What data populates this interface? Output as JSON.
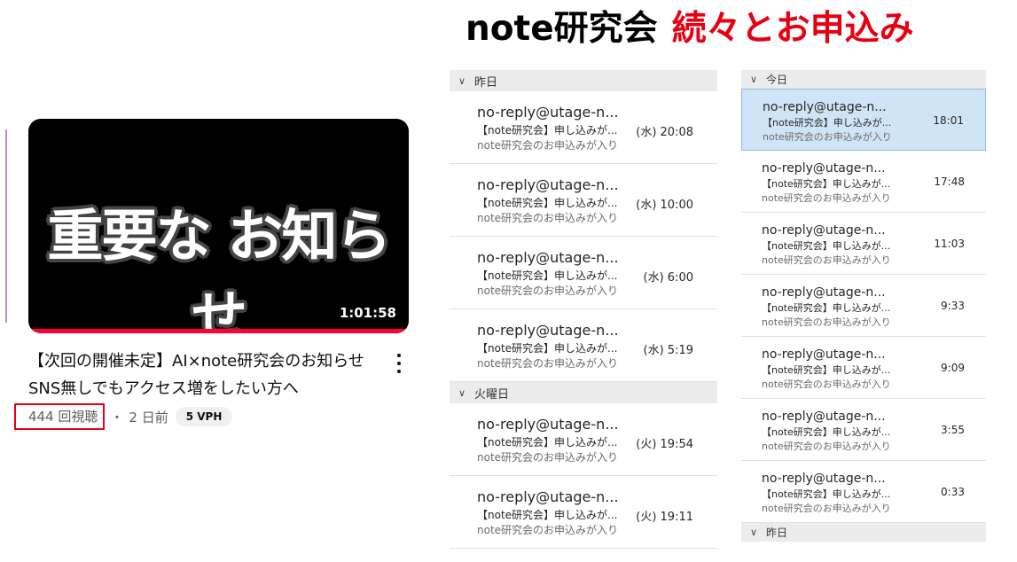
{
  "headline": {
    "part1": "note研究会",
    "part2": "続々とお申込み"
  },
  "video": {
    "thumbnail_text": "重要な お知らせ",
    "duration": "1:01:58",
    "watch_progress": 1.0,
    "title": "【次回の開催未定】AI×note研究会のお知らせ SNS無しでもアクセス増をしたい方へ",
    "views": "444 回視聴",
    "separator": "・",
    "age": "2 日前",
    "vph": "5 VPH",
    "colors": {
      "progress": "#ff0033",
      "highlight_box": "#e60012"
    }
  },
  "mail_list_1": {
    "groups": [
      {
        "label": "昨日",
        "items": [
          {
            "sender": "no-reply@utage-n...",
            "subject": "【note研究会】申し込みが...",
            "preview": "note研究会のお申込みが入り",
            "time": "(水) 20:08"
          },
          {
            "sender": "no-reply@utage-n...",
            "subject": "【note研究会】申し込みが...",
            "preview": "note研究会のお申込みが入り",
            "time": "(水) 10:00"
          },
          {
            "sender": "no-reply@utage-n...",
            "subject": "【note研究会】申し込みが...",
            "preview": "note研究会のお申込みが入り",
            "time": "(水) 6:00"
          },
          {
            "sender": "no-reply@utage-n...",
            "subject": "【note研究会】申し込みが...",
            "preview": "note研究会のお申込みが入り",
            "time": "(水) 5:19"
          }
        ]
      },
      {
        "label": "火曜日",
        "items": [
          {
            "sender": "no-reply@utage-n...",
            "subject": "【note研究会】申し込みが...",
            "preview": "note研究会のお申込みが入り",
            "time": "(火) 19:54"
          },
          {
            "sender": "no-reply@utage-n...",
            "subject": "【note研究会】申し込みが...",
            "preview": "note研究会のお申込みが入り",
            "time": "(火) 19:11"
          }
        ]
      }
    ]
  },
  "mail_list_2": {
    "groups": [
      {
        "label": "今日",
        "items": [
          {
            "sender": "no-reply@utage-n...",
            "subject": "【note研究会】申し込みが...",
            "preview": "note研究会のお申込みが入り",
            "time": "18:01",
            "selected": true
          },
          {
            "sender": "no-reply@utage-n...",
            "subject": "【note研究会】申し込みが...",
            "preview": "note研究会のお申込みが入り",
            "time": "17:48"
          },
          {
            "sender": "no-reply@utage-n...",
            "subject": "【note研究会】申し込みが...",
            "preview": "note研究会のお申込みが入り",
            "time": "11:03"
          },
          {
            "sender": "no-reply@utage-n...",
            "subject": "【note研究会】申し込みが...",
            "preview": "note研究会のお申込みが入り",
            "time": "9:33"
          },
          {
            "sender": "no-reply@utage-n...",
            "subject": "【note研究会】申し込みが...",
            "preview": "note研究会のお申込みが入り",
            "time": "9:09"
          },
          {
            "sender": "no-reply@utage-n...",
            "subject": "【note研究会】申し込みが...",
            "preview": "note研究会のお申込みが入り",
            "time": "3:55"
          },
          {
            "sender": "no-reply@utage-n...",
            "subject": "【note研究会】申し込みが...",
            "preview": "note研究会のお申込みが入り",
            "time": "0:33"
          }
        ]
      },
      {
        "label": "昨日",
        "items": []
      }
    ]
  },
  "icons": {
    "group_toggle": "chevron-down-icon",
    "menu": "more-vert-icon"
  }
}
